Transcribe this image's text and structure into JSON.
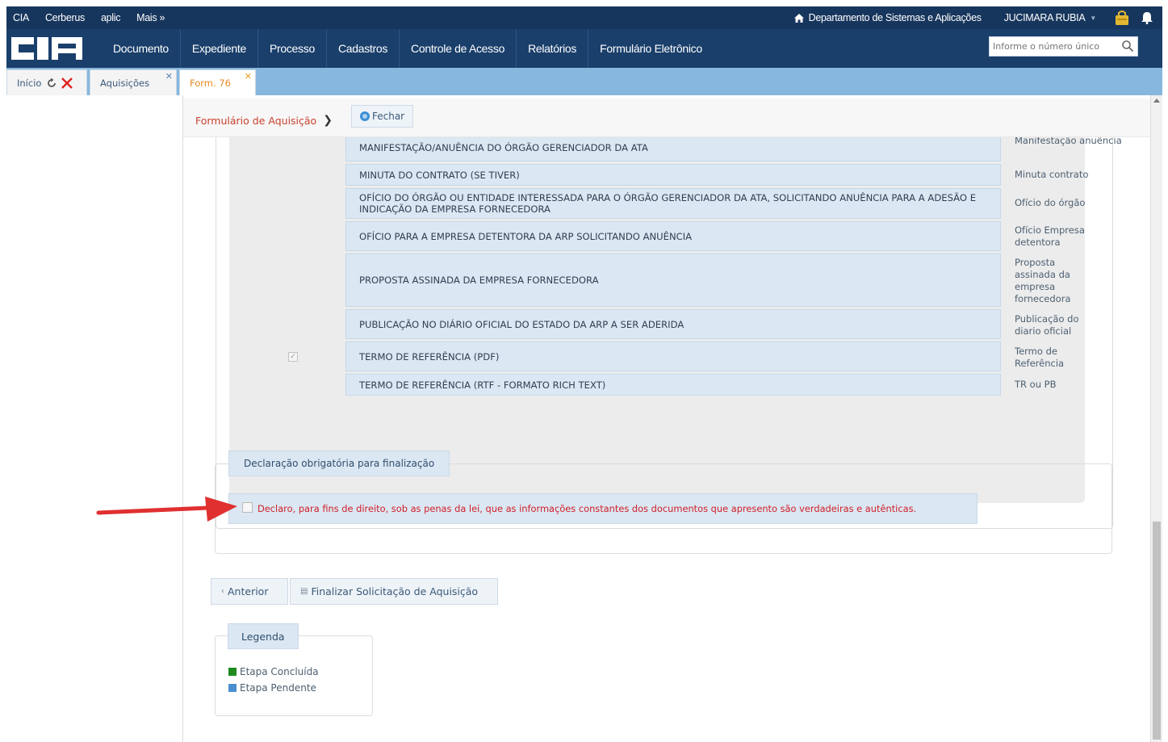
{
  "topbar": {
    "links": [
      "CIA",
      "Cerberus",
      "aplic",
      "Mais »"
    ],
    "department": "Departamento de Sistemas e Aplicações",
    "user": "JUCIMARA RUBIA"
  },
  "menubar": {
    "logo_text": "CIA",
    "items": [
      "Documento",
      "Expediente",
      "Processo",
      "Cadastros",
      "Controle de Acesso",
      "Relatórios",
      "Formulário Eletrônico"
    ],
    "search_placeholder": "Informe o número único"
  },
  "tabs": [
    {
      "label": "Início"
    },
    {
      "label": "Aquisições"
    },
    {
      "label": "Form. 76"
    }
  ],
  "page": {
    "breadcrumb": "Formulário de Aquisição",
    "close_button": "Fechar"
  },
  "documents": [
    {
      "title": "MANIFESTAÇÃO/ANUÊNCIA DO ÓRGÃO GERENCIADOR DA ATA",
      "label": "Manifestação anuência",
      "checked": false
    },
    {
      "title": "MINUTA DO CONTRATO (SE TIVER)",
      "label": "Minuta contrato",
      "checked": false
    },
    {
      "title": "OFÍCIO DO ÓRGÃO OU ENTIDADE INTERESSADA PARA O ÓRGÃO GERENCIADOR DA ATA, SOLICITANDO ANUÊNCIA PARA A ADESÃO E INDICAÇÃO DA EMPRESA FORNECEDORA",
      "label": "Ofício do órgão",
      "checked": false
    },
    {
      "title": "OFÍCIO PARA A EMPRESA DETENTORA DA ARP SOLICITANDO ANUÊNCIA",
      "label": "Ofício Empresa detentora",
      "checked": false
    },
    {
      "title": "PROPOSTA ASSINADA DA EMPRESA FORNECEDORA",
      "label": "Proposta assinada da empresa fornecedora",
      "checked": false
    },
    {
      "title": "PUBLICAÇÃO NO DIÁRIO OFICIAL DO ESTADO DA ARP A SER ADERIDA",
      "label": "Publicação do diario oficial",
      "checked": false
    },
    {
      "title": "TERMO DE REFERÊNCIA (PDF)",
      "label": "Termo de Referência",
      "checked": true
    },
    {
      "title": "TERMO DE REFERÊNCIA (RTF - FORMATO RICH TEXT)",
      "label": "TR ou PB",
      "checked": false
    }
  ],
  "declaration": {
    "legend": "Declaração obrigatória para finalização",
    "text": "Declaro, para fins de direito, sob as penas da lei, que as informações constantes dos documentos que apresento são verdadeiras e autênticas.",
    "checked": false
  },
  "actions": {
    "previous": "Anterior",
    "finish": "Finalizar Solicitação de Aquisição"
  },
  "legend": {
    "title": "Legenda",
    "items": [
      {
        "label": "Etapa Concluída",
        "color": "#1e8a1e"
      },
      {
        "label": "Etapa Pendente",
        "color": "#4a8fd0"
      }
    ]
  },
  "colors": {
    "topbar": "#17365d",
    "menubar": "#1a3f6b",
    "tabsbar": "#87b7dd",
    "doc_row": "#dbe7f2",
    "declaration_text": "#d0202a",
    "breadcrumb": "#c8412d",
    "arrow": "#e03030"
  }
}
